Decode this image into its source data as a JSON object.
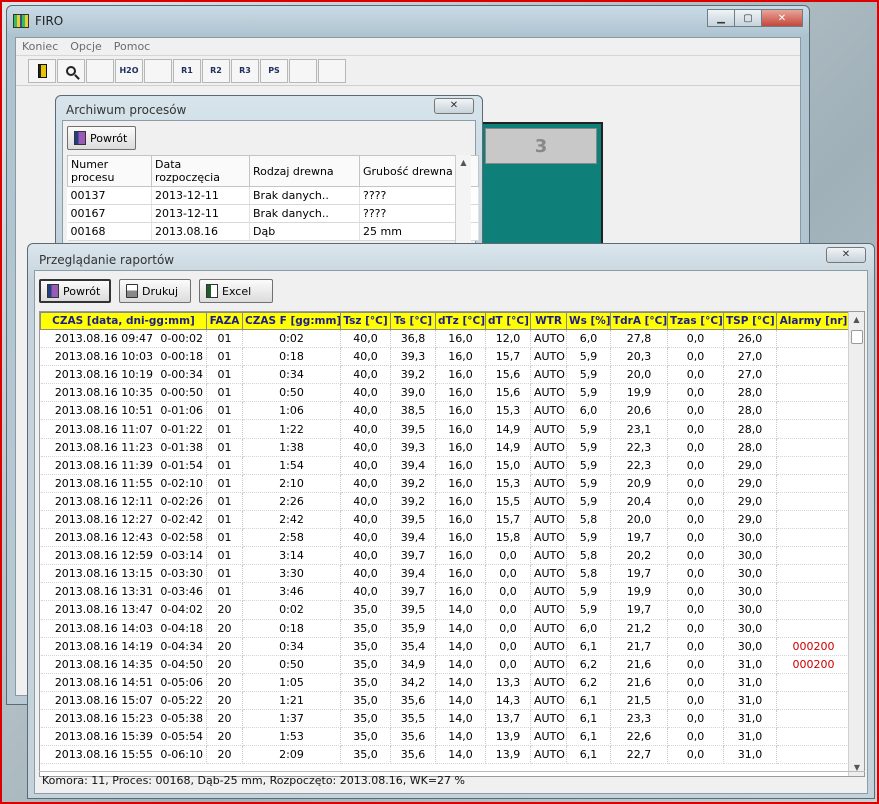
{
  "main_window": {
    "title": "FIRO",
    "menu": [
      "Koniec",
      "Opcje",
      "Pomoc"
    ],
    "toolbar": [
      "exit-door-icon",
      "search-icon",
      "chart-icon",
      "h2o-icon",
      "document-icon",
      "r1-icon",
      "r2-icon",
      "r3-icon",
      "ps-icon",
      "settings-icon",
      "printer-icon"
    ],
    "toolbar_labels": [
      "",
      "",
      "",
      "H2O",
      "",
      "R1",
      "R2",
      "R3",
      "PS",
      "",
      ""
    ],
    "chamber_number": "3"
  },
  "archive": {
    "title": "Archiwum procesów",
    "back_label": "Powrót",
    "columns": [
      "Numer procesu",
      "Data rozpoczęcia",
      "Rodzaj drewna",
      "Grubość drewna"
    ],
    "rows": [
      [
        "00137",
        "2013-12-11",
        "Brak danych..",
        "????"
      ],
      [
        "00167",
        "2013-12-11",
        "Brak danych..",
        "????"
      ],
      [
        "00168",
        "2013.08.16",
        "Dąb",
        "25 mm"
      ]
    ]
  },
  "reports": {
    "title": "Przeglądanie raportów",
    "back_label": "Powrót",
    "print_label": "Drukuj",
    "excel_label": "Excel",
    "columns": [
      "CZAS [data, dni-gg:mm]",
      "FAZA",
      "CZAS F [gg:mm]",
      "Tsz [°C]",
      "Ts [°C]",
      "dTz [°C]",
      "dT [°C]",
      "WTR",
      "Ws [%]",
      "TdrA [°C]",
      "Tzas [°C]",
      "TSP [°C]",
      "Alarmy [nr]"
    ],
    "rows": [
      [
        "2013.08.16 09:47",
        "0-00:02",
        "01",
        "0:02",
        "40,0",
        "36,8",
        "16,0",
        "12,0",
        "AUTO",
        "6,0",
        "27,8",
        "0,0",
        "26,0",
        ""
      ],
      [
        "2013.08.16 10:03",
        "0-00:18",
        "01",
        "0:18",
        "40,0",
        "39,3",
        "16,0",
        "15,7",
        "AUTO",
        "5,9",
        "20,3",
        "0,0",
        "27,0",
        ""
      ],
      [
        "2013.08.16 10:19",
        "0-00:34",
        "01",
        "0:34",
        "40,0",
        "39,2",
        "16,0",
        "15,6",
        "AUTO",
        "5,9",
        "20,0",
        "0,0",
        "27,0",
        ""
      ],
      [
        "2013.08.16 10:35",
        "0-00:50",
        "01",
        "0:50",
        "40,0",
        "39,0",
        "16,0",
        "15,6",
        "AUTO",
        "5,9",
        "19,9",
        "0,0",
        "28,0",
        ""
      ],
      [
        "2013.08.16 10:51",
        "0-01:06",
        "01",
        "1:06",
        "40,0",
        "38,5",
        "16,0",
        "15,3",
        "AUTO",
        "6,0",
        "20,6",
        "0,0",
        "28,0",
        ""
      ],
      [
        "2013.08.16 11:07",
        "0-01:22",
        "01",
        "1:22",
        "40,0",
        "39,5",
        "16,0",
        "14,9",
        "AUTO",
        "5,9",
        "23,1",
        "0,0",
        "28,0",
        ""
      ],
      [
        "2013.08.16 11:23",
        "0-01:38",
        "01",
        "1:38",
        "40,0",
        "39,3",
        "16,0",
        "14,9",
        "AUTO",
        "5,9",
        "22,3",
        "0,0",
        "28,0",
        ""
      ],
      [
        "2013.08.16 11:39",
        "0-01:54",
        "01",
        "1:54",
        "40,0",
        "39,4",
        "16,0",
        "15,0",
        "AUTO",
        "5,9",
        "22,3",
        "0,0",
        "29,0",
        ""
      ],
      [
        "2013.08.16 11:55",
        "0-02:10",
        "01",
        "2:10",
        "40,0",
        "39,2",
        "16,0",
        "15,3",
        "AUTO",
        "5,9",
        "20,9",
        "0,0",
        "29,0",
        ""
      ],
      [
        "2013.08.16 12:11",
        "0-02:26",
        "01",
        "2:26",
        "40,0",
        "39,2",
        "16,0",
        "15,5",
        "AUTO",
        "5,9",
        "20,4",
        "0,0",
        "29,0",
        ""
      ],
      [
        "2013.08.16 12:27",
        "0-02:42",
        "01",
        "2:42",
        "40,0",
        "39,5",
        "16,0",
        "15,7",
        "AUTO",
        "5,8",
        "20,0",
        "0,0",
        "29,0",
        ""
      ],
      [
        "2013.08.16 12:43",
        "0-02:58",
        "01",
        "2:58",
        "40,0",
        "39,4",
        "16,0",
        "15,8",
        "AUTO",
        "5,9",
        "19,7",
        "0,0",
        "30,0",
        ""
      ],
      [
        "2013.08.16 12:59",
        "0-03:14",
        "01",
        "3:14",
        "40,0",
        "39,7",
        "16,0",
        "0,0",
        "AUTO",
        "5,8",
        "20,2",
        "0,0",
        "30,0",
        ""
      ],
      [
        "2013.08.16 13:15",
        "0-03:30",
        "01",
        "3:30",
        "40,0",
        "39,4",
        "16,0",
        "0,0",
        "AUTO",
        "5,8",
        "19,7",
        "0,0",
        "30,0",
        ""
      ],
      [
        "2013.08.16 13:31",
        "0-03:46",
        "01",
        "3:46",
        "40,0",
        "39,7",
        "16,0",
        "0,0",
        "AUTO",
        "5,9",
        "19,9",
        "0,0",
        "30,0",
        ""
      ],
      [
        "2013.08.16 13:47",
        "0-04:02",
        "20",
        "0:02",
        "35,0",
        "39,5",
        "14,0",
        "0,0",
        "AUTO",
        "5,9",
        "19,7",
        "0,0",
        "30,0",
        ""
      ],
      [
        "2013.08.16 14:03",
        "0-04:18",
        "20",
        "0:18",
        "35,0",
        "35,9",
        "14,0",
        "0,0",
        "AUTO",
        "6,0",
        "21,2",
        "0,0",
        "30,0",
        ""
      ],
      [
        "2013.08.16 14:19",
        "0-04:34",
        "20",
        "0:34",
        "35,0",
        "35,4",
        "14,0",
        "0,0",
        "AUTO",
        "6,1",
        "21,7",
        "0,0",
        "30,0",
        "000200"
      ],
      [
        "2013.08.16 14:35",
        "0-04:50",
        "20",
        "0:50",
        "35,0",
        "34,9",
        "14,0",
        "0,0",
        "AUTO",
        "6,2",
        "21,6",
        "0,0",
        "31,0",
        "000200"
      ],
      [
        "2013.08.16 14:51",
        "0-05:06",
        "20",
        "1:05",
        "35,0",
        "34,2",
        "14,0",
        "13,3",
        "AUTO",
        "6,2",
        "21,6",
        "0,0",
        "31,0",
        ""
      ],
      [
        "2013.08.16 15:07",
        "0-05:22",
        "20",
        "1:21",
        "35,0",
        "35,6",
        "14,0",
        "14,3",
        "AUTO",
        "6,1",
        "21,5",
        "0,0",
        "31,0",
        ""
      ],
      [
        "2013.08.16 15:23",
        "0-05:38",
        "20",
        "1:37",
        "35,0",
        "35,5",
        "14,0",
        "13,7",
        "AUTO",
        "6,1",
        "23,3",
        "0,0",
        "31,0",
        ""
      ],
      [
        "2013.08.16 15:39",
        "0-05:54",
        "20",
        "1:53",
        "35,0",
        "35,6",
        "14,0",
        "13,9",
        "AUTO",
        "6,1",
        "22,6",
        "0,0",
        "31,0",
        ""
      ],
      [
        "2013.08.16 15:55",
        "0-06:10",
        "20",
        "2:09",
        "35,0",
        "35,6",
        "14,0",
        "13,9",
        "AUTO",
        "6,1",
        "22,7",
        "0,0",
        "31,0",
        ""
      ]
    ],
    "status": "Komora: 11,  Proces: 00168,  Dąb-25 mm,  Rozpoczęto: 2013.08.16,  WK=27 %"
  },
  "colors": {
    "header_bg": "#ffff00",
    "header_text": "#1d1d8a",
    "alarm": "#cc0000",
    "chamber": "#0f7f7a"
  }
}
